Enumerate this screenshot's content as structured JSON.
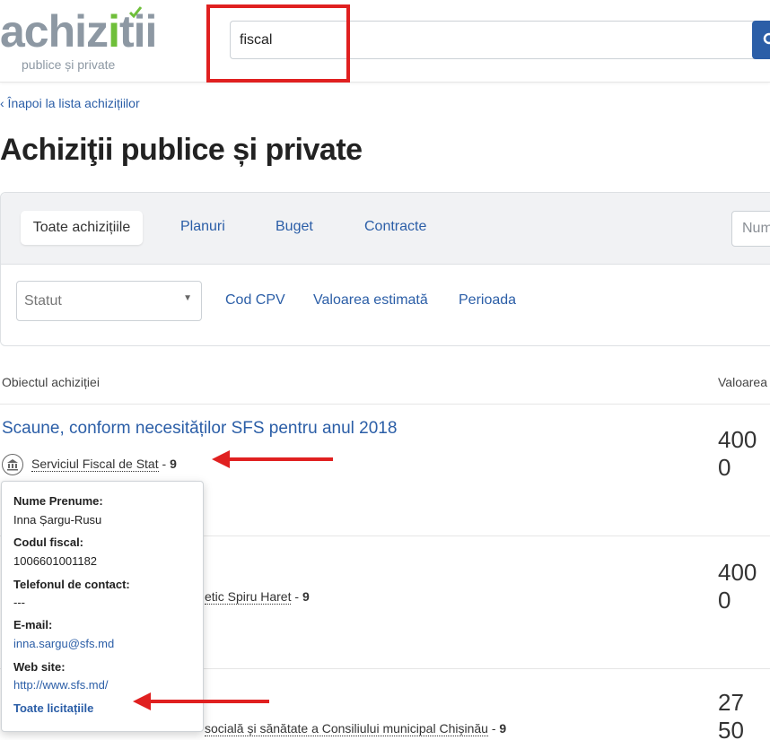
{
  "header": {
    "logo_main_prefix": "achiz",
    "logo_main_accent": "i",
    "logo_main_suffix": "tii",
    "logo_sub": "publice și private",
    "search_value": "fiscal"
  },
  "back_link": "‹ Înapoi la lista achizițiilor",
  "page_title": "Achiziţii publice și private",
  "tabs": {
    "active": "Toate achizițiile",
    "items": [
      "Planuri",
      "Buget",
      "Contracte"
    ],
    "number_placeholder": "Num"
  },
  "filters": {
    "status_select": "Statut",
    "links": [
      "Cod CPV",
      "Valoarea estimată",
      "Perioada"
    ]
  },
  "table": {
    "columns": [
      "Obiectul achiziției",
      "Valoarea"
    ],
    "rows": [
      {
        "title": "Scaune, conform necesităților SFS pentru anul 2018",
        "org": "Serviciul Fiscal de Stat",
        "count": "9",
        "value": "400 0"
      },
      {
        "org_tail": "etic Spiru Haret",
        "count": "9",
        "value": "400 0"
      },
      {
        "org_tail": "socială și sănătate a Consiliului municipal Chișinău",
        "count": "9",
        "value": "27 50"
      }
    ]
  },
  "popover": {
    "name_label": "Nume Prenume:",
    "name_value": "Inna Șargu-Rusu",
    "fiscal_label": "Codul fiscal:",
    "fiscal_value": "1006601001182",
    "phone_label": "Telefonul de contact:",
    "phone_value": "---",
    "email_label": "E-mail:",
    "email_value": "inna.sargu@sfs.md",
    "web_label": "Web site:",
    "web_value": "http://www.sfs.md/",
    "all_link": "Toate licitațiile"
  },
  "colors": {
    "link": "#2b5ea7",
    "logo_gray": "#8d98a3",
    "logo_green": "#6fbf3a",
    "annotation_red": "#e02020"
  }
}
